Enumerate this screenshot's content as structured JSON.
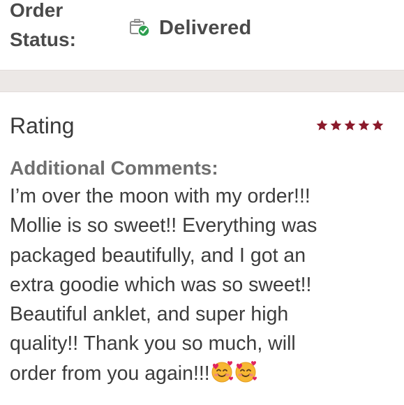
{
  "order_status": {
    "label": "Order\nStatus:",
    "value": "Delivered",
    "icon": "package-check-icon",
    "icon_badge_color": "#2e9e4f"
  },
  "rating": {
    "label": "Rating",
    "stars": 5,
    "max_stars": 5,
    "star_color": "#8b1a2b"
  },
  "comments": {
    "label": "Additional Comments:",
    "text": "I’m over the moon with my order!!!\nMollie is so sweet!! Everything was\npackaged beautifully, and I got an\nextra goodie which was so sweet!!\nBeautiful anklet, and super high\nquality!! Thank you so much, will\norder from you again!!!",
    "emojis": [
      "smiling-face-with-hearts",
      "smiling-face-with-hearts"
    ]
  }
}
